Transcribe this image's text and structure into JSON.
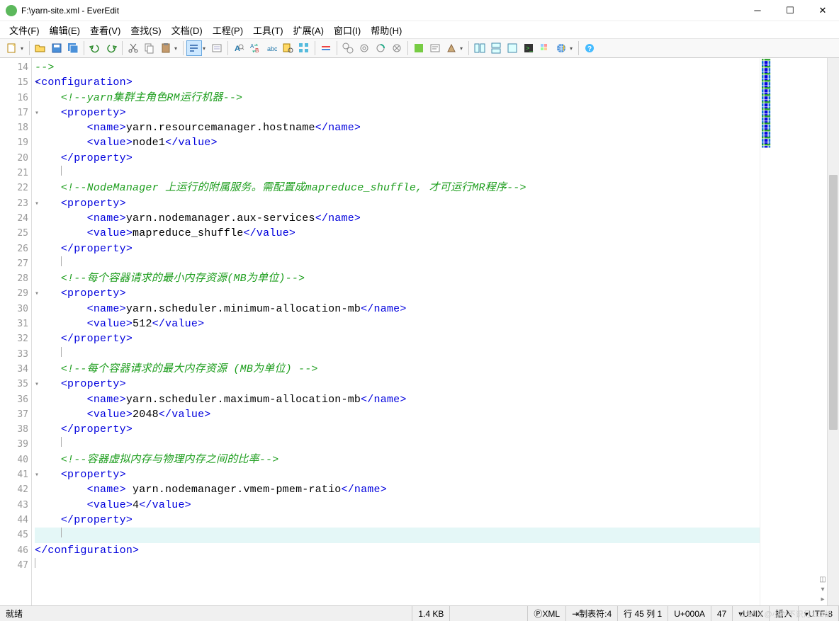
{
  "title": "F:\\yarn-site.xml - EverEdit",
  "menus": [
    "文件(F)",
    "编辑(E)",
    "查看(V)",
    "查找(S)",
    "文档(D)",
    "工程(P)",
    "工具(T)",
    "扩展(A)",
    "窗口(I)",
    "帮助(H)"
  ],
  "lines": [
    {
      "n": 14,
      "t": "comment",
      "txt": "-->"
    },
    {
      "n": 15,
      "t": "tag",
      "txt": "<configuration>",
      "fold": true
    },
    {
      "n": 16,
      "t": "comment",
      "indent": 1,
      "txt": "<!--yarn集群主角色RM运行机器-->"
    },
    {
      "n": 17,
      "t": "tag",
      "indent": 1,
      "txt": "<property>",
      "fold": true
    },
    {
      "n": 18,
      "t": "nv",
      "indent": 2,
      "open": "<name>",
      "val": "yarn.resourcemanager.hostname",
      "close": "</name>"
    },
    {
      "n": 19,
      "t": "nv",
      "indent": 2,
      "open": "<value>",
      "val": "node1",
      "close": "</value>"
    },
    {
      "n": 20,
      "t": "tag",
      "indent": 1,
      "txt": "</property>"
    },
    {
      "n": 21,
      "t": "blank",
      "indent": 1
    },
    {
      "n": 22,
      "t": "comment",
      "indent": 1,
      "txt": "<!--NodeManager 上运行的附属服务。需配置成mapreduce_shuffle, 才可运行MR程序-->"
    },
    {
      "n": 23,
      "t": "tag",
      "indent": 1,
      "txt": "<property>",
      "fold": true
    },
    {
      "n": 24,
      "t": "nv",
      "indent": 2,
      "open": "<name>",
      "val": "yarn.nodemanager.aux-services",
      "close": "</name>"
    },
    {
      "n": 25,
      "t": "nv",
      "indent": 2,
      "open": "<value>",
      "val": "mapreduce_shuffle",
      "close": "</value>"
    },
    {
      "n": 26,
      "t": "tag",
      "indent": 1,
      "txt": "</property>"
    },
    {
      "n": 27,
      "t": "blank",
      "indent": 1
    },
    {
      "n": 28,
      "t": "comment",
      "indent": 1,
      "txt": "<!--每个容器请求的最小内存资源(MB为单位)-->"
    },
    {
      "n": 29,
      "t": "tag",
      "indent": 1,
      "txt": "<property>",
      "fold": true
    },
    {
      "n": 30,
      "t": "nv",
      "indent": 2,
      "open": "<name>",
      "val": "yarn.scheduler.minimum-allocation-mb",
      "close": "</name>"
    },
    {
      "n": 31,
      "t": "nv",
      "indent": 2,
      "open": "<value>",
      "val": "512",
      "close": "</value>"
    },
    {
      "n": 32,
      "t": "tag",
      "indent": 1,
      "txt": "</property>"
    },
    {
      "n": 33,
      "t": "blank",
      "indent": 1
    },
    {
      "n": 34,
      "t": "comment",
      "indent": 1,
      "txt": "<!--每个容器请求的最大内存资源 (MB为单位) -->"
    },
    {
      "n": 35,
      "t": "tag",
      "indent": 1,
      "txt": "<property>",
      "fold": true
    },
    {
      "n": 36,
      "t": "nv",
      "indent": 2,
      "open": "<name>",
      "val": "yarn.scheduler.maximum-allocation-mb",
      "close": "</name>"
    },
    {
      "n": 37,
      "t": "nv",
      "indent": 2,
      "open": "<value>",
      "val": "2048",
      "close": "</value>"
    },
    {
      "n": 38,
      "t": "tag",
      "indent": 1,
      "txt": "</property>"
    },
    {
      "n": 39,
      "t": "blank",
      "indent": 1
    },
    {
      "n": 40,
      "t": "comment",
      "indent": 1,
      "txt": "<!--容器虚拟内存与物理内存之间的比率-->"
    },
    {
      "n": 41,
      "t": "tag",
      "indent": 1,
      "txt": "<property>",
      "fold": true
    },
    {
      "n": 42,
      "t": "nv",
      "indent": 2,
      "open": "<name>",
      "val": " yarn.nodemanager.vmem-pmem-ratio",
      "close": "</name>"
    },
    {
      "n": 43,
      "t": "nv",
      "indent": 2,
      "open": "<value>",
      "val": "4",
      "close": "</value>"
    },
    {
      "n": 44,
      "t": "tag",
      "indent": 1,
      "txt": "</property>"
    },
    {
      "n": 45,
      "t": "blank",
      "indent": 1,
      "cur": true
    },
    {
      "n": 46,
      "t": "tag",
      "txt": "</configuration>"
    },
    {
      "n": 47,
      "t": "blank"
    }
  ],
  "status": {
    "ready": "就绪",
    "size": "1.4 KB",
    "lang": "XML",
    "tab": "制表符:4",
    "pos": "行 45 列 1",
    "code": "U+000A",
    "len": "47",
    "eol": "UNIX",
    "ins": "插入",
    "enc": "UTF-8"
  },
  "watermark": "CSDN @小时不识月123胡"
}
